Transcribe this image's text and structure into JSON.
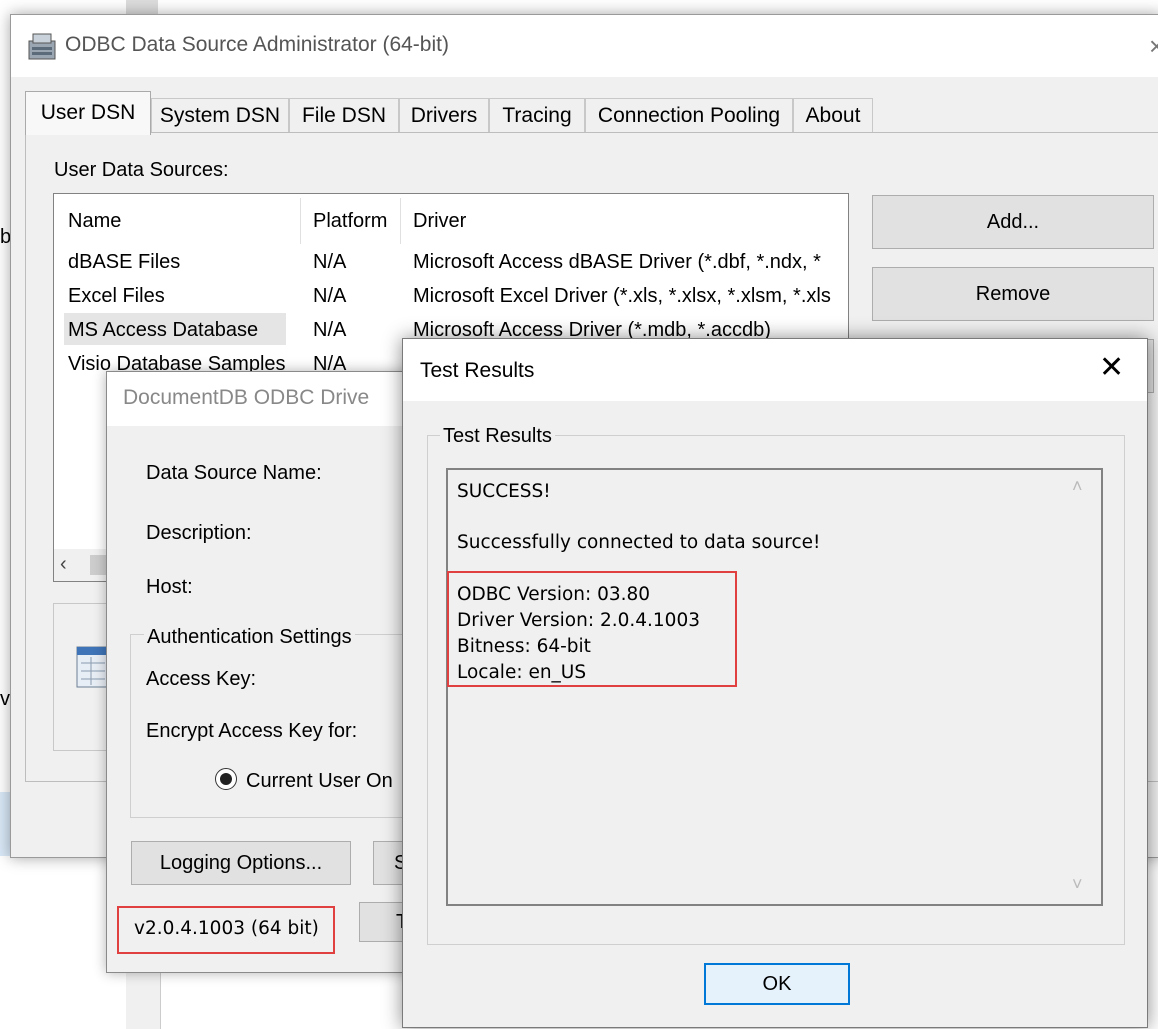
{
  "odbc_window": {
    "title": "ODBC Data Source Administrator (64-bit)",
    "tabs": [
      "User DSN",
      "System DSN",
      "File DSN",
      "Drivers",
      "Tracing",
      "Connection Pooling",
      "About"
    ],
    "list_label": "User Data Sources:",
    "columns": [
      "Name",
      "Platform",
      "Driver"
    ],
    "rows": [
      {
        "name": "dBASE Files",
        "platform": "N/A",
        "driver": "Microsoft Access dBASE Driver (*.dbf, *.ndx, *"
      },
      {
        "name": "Excel Files",
        "platform": "N/A",
        "driver": "Microsoft Excel Driver (*.xls, *.xlsx, *.xlsm, *.xls"
      },
      {
        "name": "MS Access Database",
        "platform": "N/A",
        "driver": "Microsoft Access Driver (*.mdb, *.accdb)"
      },
      {
        "name": "Visio Database Samples",
        "platform": "N/A",
        "driver": ""
      }
    ],
    "add_button": "Add...",
    "remove_button": "Remove"
  },
  "docdb_dialog": {
    "title": "DocumentDB ODBC Drive",
    "data_source_name_label": "Data Source Name:",
    "description_label": "Description:",
    "host_label": "Host:",
    "auth_group_label": "Authentication Settings",
    "access_key_label": "Access Key:",
    "encrypt_label": "Encrypt Access Key for:",
    "radio_current_user": "Current User On",
    "logging_button": "Logging Options...",
    "partial_button_1": "S",
    "partial_button_2": "T",
    "version": "v2.0.4.1003 (64 bit)"
  },
  "test_results": {
    "title": "Test Results",
    "group_label": "Test Results",
    "line_success": "SUCCESS!",
    "line_connected": "Successfully connected to data source!",
    "odbc_version": "ODBC Version: 03.80",
    "driver_version": "Driver Version: 2.0.4.1003",
    "bitness": "Bitness: 64-bit",
    "locale": "Locale: en_US",
    "ok_button": "OK"
  },
  "colors": {
    "highlight_red": "#e04040",
    "ok_border": "#0078d7"
  }
}
